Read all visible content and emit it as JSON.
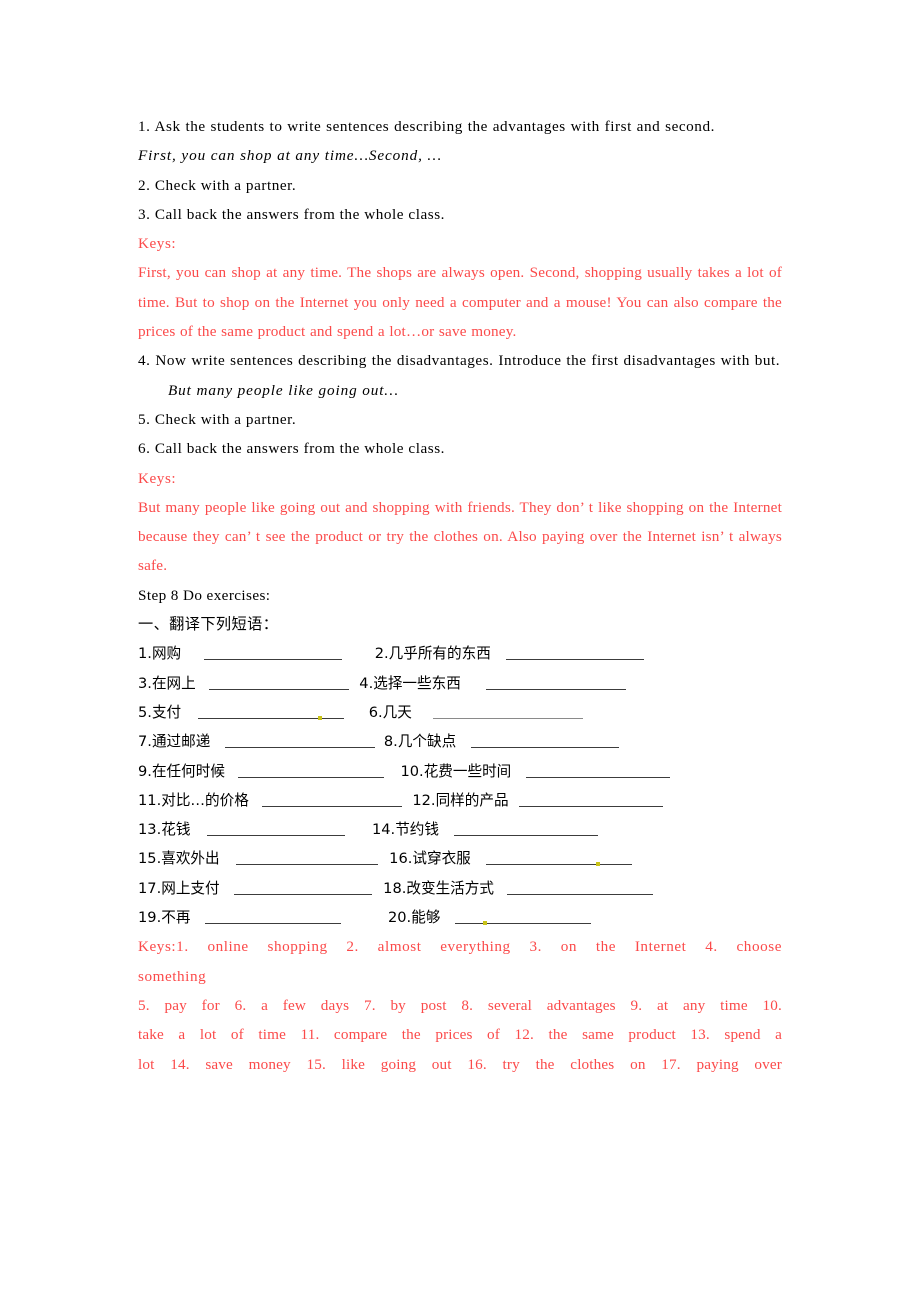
{
  "document": {
    "type": "lesson-plan-worksheet",
    "colors": {
      "body_text": "#000000",
      "answer_key_red": "#fb4a4a",
      "rule_line": "#3c3c3c",
      "proofing_mark_green": "#c9c317",
      "page_background": "#ffffff"
    }
  },
  "body": {
    "step_advantages": {
      "item1": "1. Ask the students to write sentences describing the advantages with first and second.",
      "example1": "First, you can shop at any time…Second, …",
      "item2": "2. Check with a partner.",
      "item3": "3. Call back the answers from the whole class."
    },
    "keys1": {
      "label": "Keys:",
      "text": "First, you can shop at any time. The shops are always open. Second, shopping usually takes a lot of time. But to shop on the Internet you only need a computer and a mouse! You can also compare the prices of the same product and spend a lot…or save money."
    },
    "step_disadvantages": {
      "item4": "4. Now write sentences describing the disadvantages. Introduce the first disadvantages with but.",
      "example2": "But many people like going out…",
      "item5": "5. Check with a partner.",
      "item6": "6. Call back the answers from the whole class."
    },
    "keys2": {
      "label": "Keys:",
      "text": "But many people like going out and shopping with friends. They don’ t like shopping on the Internet because they can’ t see the product or try the clothes on. Also paying over the Internet isn’ t always safe."
    },
    "step8": {
      "heading": "Step 8 Do exercises:",
      "subheading": "一、翻译下列短语："
    }
  },
  "exercises": [
    {
      "num": "1.",
      "cn": "网购"
    },
    {
      "num": "2.",
      "cn": "几乎所有的东西"
    },
    {
      "num": "3.",
      "cn": "在网上"
    },
    {
      "num": "4.",
      "cn": "选择一些东西"
    },
    {
      "num": "5.",
      "cn": "支付"
    },
    {
      "num": "6.",
      "cn": "几天"
    },
    {
      "num": "7.",
      "cn": "通过邮递"
    },
    {
      "num": "8.",
      "cn": "几个缺点"
    },
    {
      "num": "9.",
      "cn": "在任何时候"
    },
    {
      "num": "10.",
      "cn": "花费一些时间"
    },
    {
      "num": "11.",
      "cn": "对比…的价格"
    },
    {
      "num": "12.",
      "cn": "同样的产品"
    },
    {
      "num": "13.",
      "cn": "花钱"
    },
    {
      "num": "14.",
      "cn": "节约钱"
    },
    {
      "num": "15.",
      "cn": "喜欢外出"
    },
    {
      "num": "16.",
      "cn": "试穿衣服"
    },
    {
      "num": "17.",
      "cn": "网上支付"
    },
    {
      "num": "18.",
      "cn": "改变生活方式"
    },
    {
      "num": "19.",
      "cn": "不再"
    },
    {
      "num": "20.",
      "cn": "能够"
    }
  ],
  "exercise_keys": {
    "line1": "Keys:1. online shopping  2. almost everything  3. on the Internet  4. choose",
    "line2": "something",
    "line3": "5. pay for     6. a few days  7. by post  8. several advantages 9. at any time  10.",
    "line4": "take a lot of time  11. compare the prices of  12. the same product  13. spend a",
    "line5": "lot   14. save money  15. like going out  16. try the clothes on 17. paying over"
  }
}
